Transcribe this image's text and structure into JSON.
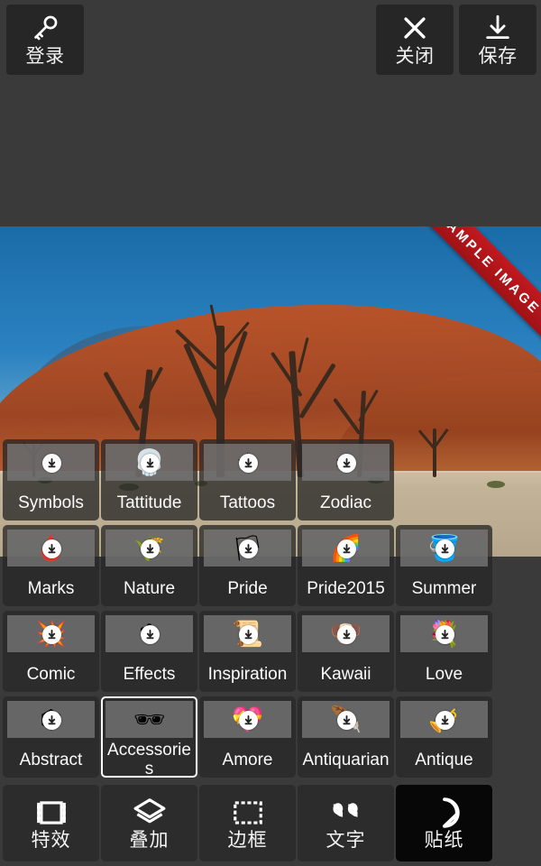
{
  "topbar": {
    "login": {
      "label": "登录",
      "icon": "key-icon"
    },
    "close": {
      "label": "关闭",
      "icon": "close-x-icon"
    },
    "save": {
      "label": "保存",
      "icon": "download-save-icon"
    }
  },
  "photo": {
    "ribbon_text": "SAMPLE IMAGE",
    "scene": "desert-dead-trees",
    "colors": {
      "sky": "#2b82c0",
      "dune": "#ab4d27",
      "pan": "#c2b296",
      "ribbon": "#c2191f"
    }
  },
  "grid": {
    "badge_icon": "download-arrow-icon",
    "rows": [
      [
        {
          "label": "Symbols",
          "art": "♣",
          "badge": true,
          "selected": false,
          "opaque": false
        },
        {
          "label": "Tattitude",
          "art": "💀",
          "badge": true,
          "selected": false,
          "opaque": false
        },
        {
          "label": "Tattoos",
          "art": "★",
          "badge": true,
          "selected": false,
          "opaque": false
        },
        {
          "label": "Zodiac",
          "art": "♒",
          "badge": true,
          "selected": false,
          "opaque": false
        }
      ],
      [
        {
          "label": "Marks",
          "art": "🩸",
          "badge": true,
          "selected": false,
          "opaque": false
        },
        {
          "label": "Nature",
          "art": "🌾",
          "badge": true,
          "selected": false,
          "opaque": false
        },
        {
          "label": "Pride",
          "art": "🏳",
          "badge": true,
          "selected": false,
          "opaque": false
        },
        {
          "label": "Pride2015",
          "art": "🌈",
          "badge": true,
          "selected": false,
          "opaque": false
        },
        {
          "label": "Summer",
          "art": "🪣",
          "badge": true,
          "selected": false,
          "opaque": false
        }
      ],
      [
        {
          "label": "Comic",
          "art": "💥",
          "badge": true,
          "selected": false,
          "opaque": true
        },
        {
          "label": "Effects",
          "art": "❇",
          "badge": true,
          "selected": false,
          "opaque": true
        },
        {
          "label": "Inspiration",
          "art": "📜",
          "badge": true,
          "selected": false,
          "opaque": true
        },
        {
          "label": "Kawaii",
          "art": "🐶",
          "badge": true,
          "selected": false,
          "opaque": true
        },
        {
          "label": "Love",
          "art": "💐",
          "badge": true,
          "selected": false,
          "opaque": true
        }
      ],
      [
        {
          "label": "Abstract",
          "art": "⬡",
          "badge": true,
          "selected": false,
          "opaque": true
        },
        {
          "label": "Accessories",
          "art": "🕶",
          "badge": false,
          "selected": true,
          "opaque": true
        },
        {
          "label": "Amore",
          "art": "💝",
          "badge": true,
          "selected": false,
          "opaque": true
        },
        {
          "label": "Antiquarian",
          "art": "🪶",
          "badge": true,
          "selected": false,
          "opaque": true
        },
        {
          "label": "Antique",
          "art": "🎺",
          "badge": true,
          "selected": false,
          "opaque": true
        }
      ]
    ]
  },
  "bottombar": {
    "tabs": [
      {
        "label": "特效",
        "icon": "film-strip-icon",
        "active": false
      },
      {
        "label": "叠加",
        "icon": "layers-icon",
        "active": false
      },
      {
        "label": "边框",
        "icon": "frame-icon",
        "active": false
      },
      {
        "label": "文字",
        "icon": "quote-marks-icon",
        "active": false
      },
      {
        "label": "贴纸",
        "icon": "sticker-icon",
        "active": true
      }
    ]
  }
}
